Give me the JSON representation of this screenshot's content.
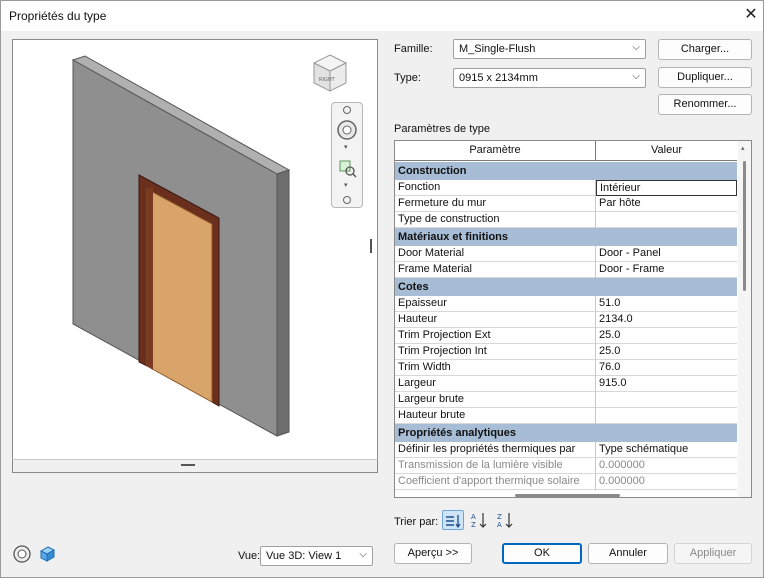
{
  "window": {
    "title": "Propriétés du type"
  },
  "family": {
    "label": "Famille:",
    "value": "M_Single-Flush"
  },
  "type": {
    "label": "Type:",
    "value": "0915 x 2134mm"
  },
  "buttons": {
    "load": "Charger...",
    "duplicate": "Dupliquer...",
    "rename": "Renommer...",
    "preview": "Aperçu >>",
    "ok": "OK",
    "cancel": "Annuler",
    "apply": "Appliquer"
  },
  "params_title": "Paramètres de type",
  "grid": {
    "headers": [
      "Paramètre",
      "Valeur"
    ],
    "sections": [
      {
        "name": "Construction",
        "rows": [
          {
            "param": "Fonction",
            "value": "Intérieur"
          },
          {
            "param": "Fermeture du mur",
            "value": "Par hôte"
          },
          {
            "param": "Type de construction",
            "value": ""
          }
        ]
      },
      {
        "name": "Matériaux et finitions",
        "rows": [
          {
            "param": "Door Material",
            "value": "Door - Panel"
          },
          {
            "param": "Frame Material",
            "value": "Door - Frame"
          }
        ]
      },
      {
        "name": "Cotes",
        "rows": [
          {
            "param": "Epaisseur",
            "value": "51.0"
          },
          {
            "param": "Hauteur",
            "value": "2134.0"
          },
          {
            "param": "Trim Projection Ext",
            "value": "25.0"
          },
          {
            "param": "Trim Projection Int",
            "value": "25.0"
          },
          {
            "param": "Trim Width",
            "value": "76.0"
          },
          {
            "param": "Largeur",
            "value": "915.0"
          },
          {
            "param": "Largeur brute",
            "value": ""
          },
          {
            "param": "Hauteur brute",
            "value": ""
          }
        ]
      },
      {
        "name": "Propriétés analytiques",
        "rows": [
          {
            "param": "Définir les propriétés thermiques par",
            "value": "Type schématique"
          },
          {
            "param": "Transmission de la lumière visible",
            "value": "0.000000",
            "grey": true
          },
          {
            "param": "Coefficient d'apport thermique solaire",
            "value": "0.000000",
            "grey": true
          }
        ]
      }
    ]
  },
  "sort": {
    "label": "Trier par:"
  },
  "view": {
    "label": "Vue:",
    "value": "Vue 3D: View 1"
  },
  "viewcube": {
    "text": "RIGHT"
  },
  "colors": {
    "accent": "#0067c0",
    "category_bg": "#a7bdd6",
    "door": "#d9a46a",
    "frame": "#6b2f1e",
    "wall": "#8f8f8f"
  },
  "icons": [
    "close-icon",
    "viewcube-icon",
    "steering-wheel-icon",
    "zoom-icon",
    "sort-category-icon",
    "sort-asc-icon",
    "sort-desc-icon",
    "orbit-icon",
    "3d-box-icon"
  ]
}
